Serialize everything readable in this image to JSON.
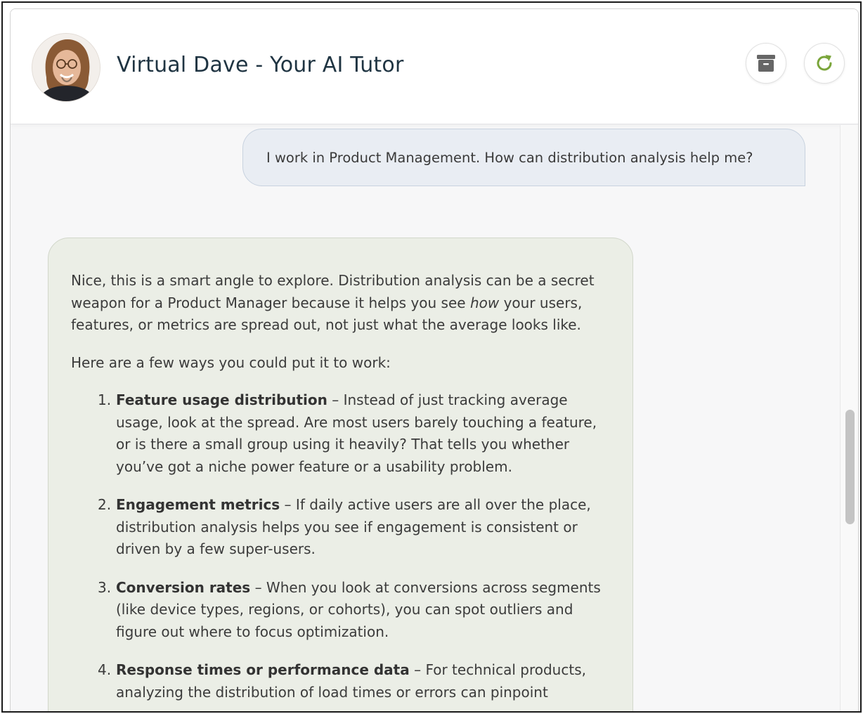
{
  "header": {
    "title": "Virtual Dave - Your AI Tutor",
    "avatar_icon": "tutor-avatar",
    "archive_icon": "archive-icon",
    "refresh_icon": "refresh-icon",
    "accent_color": "#7aa53a"
  },
  "chat": {
    "user_message": "I work in Product Management. How can distribution analysis help me?",
    "bot": {
      "intro_part1": "Nice, this is a smart angle to explore. Distribution analysis can be a secret weapon for a Product Manager because it helps you see ",
      "intro_emphasis": "how",
      "intro_part2": " your users, features, or metrics are spread out, not just what the average looks like.",
      "lead": "Here are a few ways you could put it to work:",
      "items": [
        {
          "num": "1.",
          "title": "Feature usage distribution",
          "text": " – Instead of just tracking average usage, look at the spread. Are most users barely touching a feature, or is there a small group using it heavily? That tells you whether you’ve got a niche power feature or a usability problem."
        },
        {
          "num": "2.",
          "title": "Engagement metrics",
          "text": " – If daily active users are all over the place, distribution analysis helps you see if engagement is consistent or driven by a few super-users."
        },
        {
          "num": "3.",
          "title": "Conversion rates",
          "text": " – When you look at conversions across segments (like device types, regions, or cohorts), you can spot outliers and figure out where to focus optimization."
        },
        {
          "num": "4.",
          "title": "Response times or performance data",
          "text": " – For technical products, analyzing the distribution of load times or errors can pinpoint"
        }
      ]
    }
  }
}
